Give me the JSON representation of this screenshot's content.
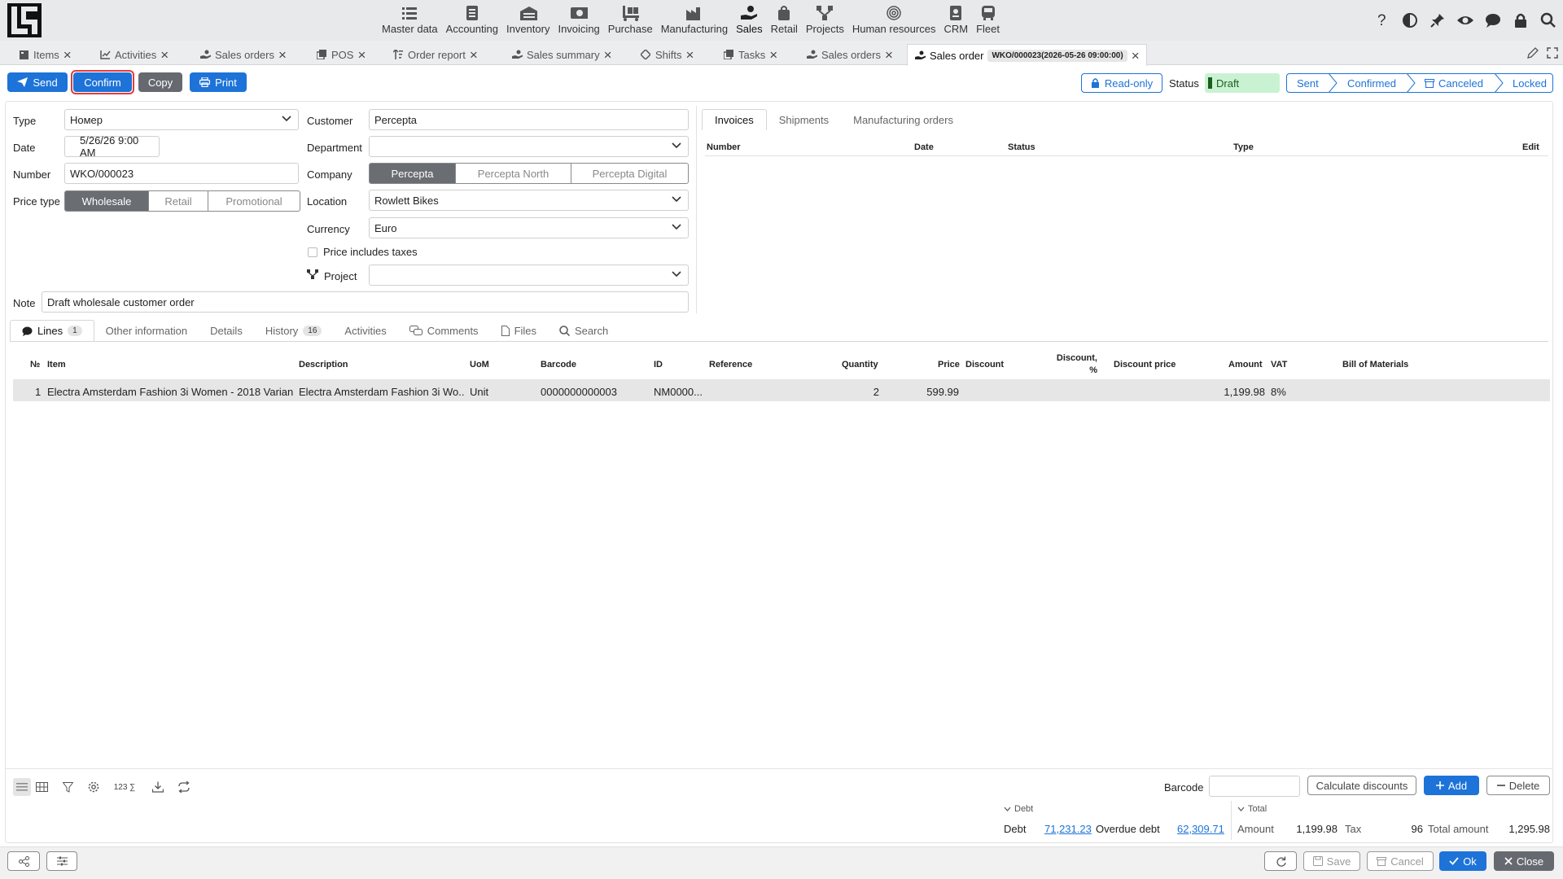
{
  "modules": [
    {
      "label": "Master data",
      "icon": "list-icon"
    },
    {
      "label": "Accounting",
      "icon": "ledger-icon"
    },
    {
      "label": "Inventory",
      "icon": "warehouse-icon"
    },
    {
      "label": "Invoicing",
      "icon": "money-icon"
    },
    {
      "label": "Purchase",
      "icon": "dolly-icon"
    },
    {
      "label": "Manufacturing",
      "icon": "factory-icon"
    },
    {
      "label": "Sales",
      "icon": "hand-coin-icon"
    },
    {
      "label": "Retail",
      "icon": "shopping-bag-icon"
    },
    {
      "label": "Projects",
      "icon": "diagram-icon"
    },
    {
      "label": "Human resources",
      "icon": "fingerprint-icon"
    },
    {
      "label": "CRM",
      "icon": "id-card-icon"
    },
    {
      "label": "Fleet",
      "icon": "bus-icon"
    }
  ],
  "tabs": [
    {
      "label": "Items",
      "icon": "items-icon"
    },
    {
      "label": "Activities",
      "icon": "chart-icon"
    },
    {
      "label": "Sales orders",
      "icon": "hand-coin-icon"
    },
    {
      "label": "POS",
      "icon": "copy-icon"
    },
    {
      "label": "Order report",
      "icon": "sort-icon"
    },
    {
      "label": "Sales summary",
      "icon": "hand-coin-icon"
    },
    {
      "label": "Shifts",
      "icon": "diamond-icon"
    },
    {
      "label": "Tasks",
      "icon": "copy-icon"
    },
    {
      "label": "Sales orders",
      "icon": "hand-coin-icon"
    },
    {
      "label": "Sales order",
      "icon": "hand-coin-icon",
      "chip": "WKO/000023(2026-05-26 09:00:00)"
    }
  ],
  "toolbar": {
    "send": "Send",
    "confirm": "Confirm",
    "copy": "Copy",
    "print": "Print",
    "readonly": "Read-only",
    "status_label": "Status",
    "status_value": "Draft"
  },
  "workflow": [
    "Sent",
    "Confirmed",
    "Canceled",
    "Locked"
  ],
  "form": {
    "type_label": "Type",
    "type_value": "Номер",
    "date_label": "Date",
    "date_value": "5/26/26 9:00 AM",
    "number_label": "Number",
    "number_value": "WKO/000023",
    "price_type_label": "Price type",
    "price_types": [
      "Wholesale",
      "Retail",
      "Promotional"
    ],
    "customer_label": "Customer",
    "customer_value": "Percepta",
    "department_label": "Department",
    "department_value": "",
    "company_label": "Company",
    "companies": [
      "Percepta",
      "Percepta North",
      "Percepta Digital"
    ],
    "location_label": "Location",
    "location_value": "Rowlett Bikes",
    "currency_label": "Currency",
    "currency_value": "Euro",
    "taxes_label": "Price includes taxes",
    "project_label": "Project",
    "project_value": "",
    "note_label": "Note",
    "note_value": "Draft wholesale customer order"
  },
  "related": {
    "tabs": [
      "Invoices",
      "Shipments",
      "Manufacturing orders"
    ],
    "columns": [
      "Number",
      "Date",
      "Status",
      "Type",
      "Edit"
    ]
  },
  "line_tabs": [
    {
      "label": "Lines",
      "badge": "1"
    },
    {
      "label": "Other information",
      "badge": ""
    },
    {
      "label": "Details",
      "badge": ""
    },
    {
      "label": "History",
      "badge": "16"
    },
    {
      "label": "Activities",
      "badge": ""
    },
    {
      "label": "Comments",
      "badge": ""
    },
    {
      "label": "Files",
      "badge": ""
    },
    {
      "label": "Search",
      "badge": ""
    }
  ],
  "lines": {
    "columns": [
      "№",
      "Item",
      "Description",
      "UoM",
      "Barcode",
      "ID",
      "Reference",
      "Quantity",
      "Price",
      "Discount",
      "Discount, %",
      "Discount price",
      "Amount",
      "VAT",
      "Bill of Materials"
    ],
    "rows": [
      {
        "no": "1",
        "item": "Electra Amsterdam Fashion 3i Women - 2018 Varian...",
        "description": "Electra Amsterdam Fashion 3i Wo...",
        "uom": "Unit",
        "barcode": "0000000000003",
        "id": "NM0000...",
        "reference": "",
        "quantity": "2",
        "price": "599.99",
        "discount": "",
        "discount_pct": "",
        "discount_price": "",
        "amount": "1,199.98",
        "vat": "8%",
        "bom": ""
      }
    ]
  },
  "bottom": {
    "barcode_label": "Barcode",
    "calc": "Calculate discounts",
    "add": "Add",
    "delete": "Delete",
    "sum_icon_text": "123 ∑",
    "debt_caption": "Debt",
    "debt_label": "Debt",
    "debt_value": "71,231.23",
    "overdue_label": "Overdue debt",
    "overdue_value": "62,309.71",
    "total_caption": "Total",
    "amount_label": "Amount",
    "amount_value": "1,199.98",
    "tax_label": "Tax",
    "tax_value": "96",
    "total_label": "Total amount",
    "total_value": "1,295.98"
  },
  "footer": {
    "save": "Save",
    "cancel": "Cancel",
    "ok": "Ok",
    "close": "Close"
  },
  "colors": {
    "accent": "#1d73d8",
    "draft": "#c9f2d2",
    "highlight": "#e23b3b"
  }
}
